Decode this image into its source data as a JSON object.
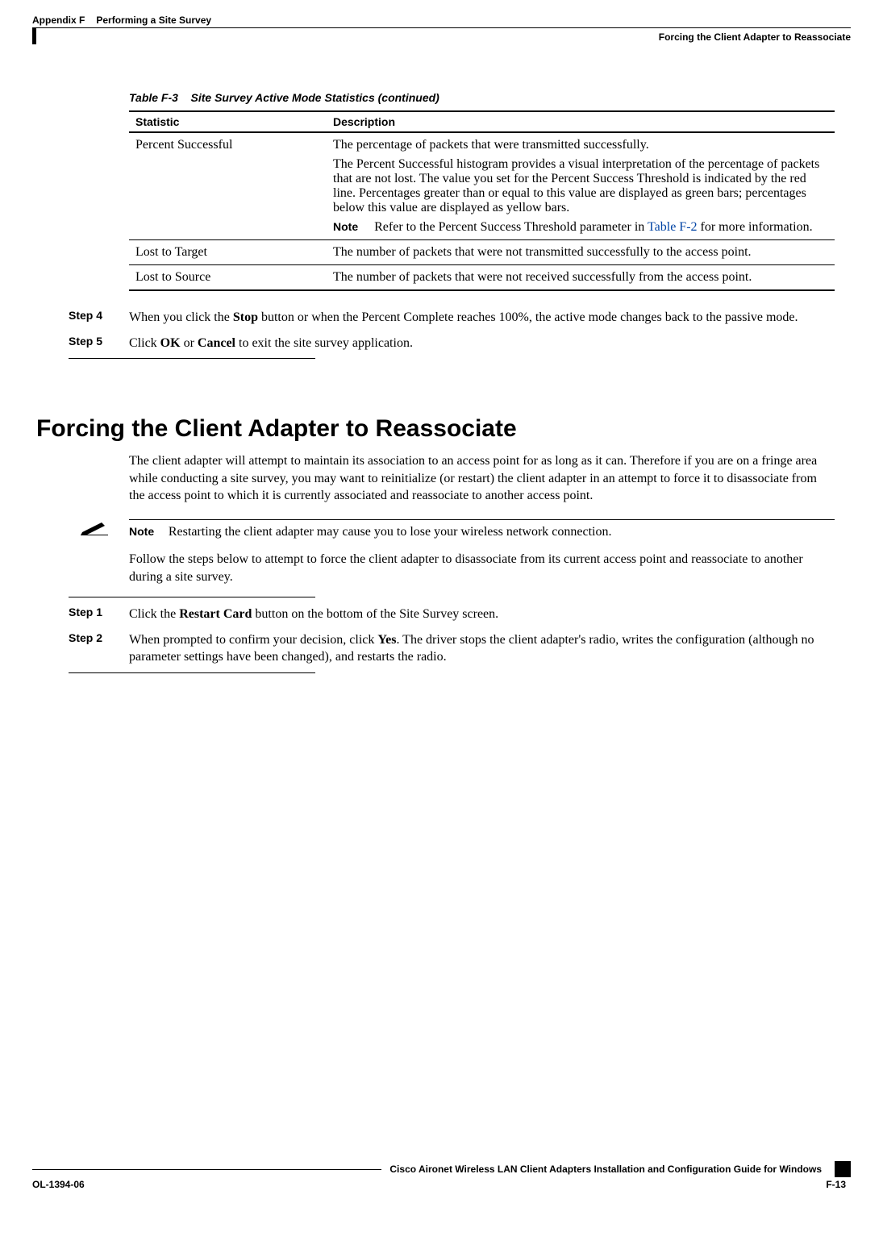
{
  "header": {
    "appendix": "Appendix F",
    "appendix_title": "Performing a Site Survey",
    "section_crumb": "Forcing the Client Adapter to Reassociate"
  },
  "table": {
    "caption_prefix": "Table F-3",
    "caption_title": "Site Survey Active Mode Statistics (continued)",
    "col1": "Statistic",
    "col2": "Description",
    "rows": [
      {
        "stat": "Percent Successful",
        "desc_p1": "The percentage of packets that were transmitted successfully.",
        "desc_p2": "The Percent Successful histogram provides a visual interpretation of the percentage of packets that are not lost. The value you set for the Percent Success Threshold is indicated by the red line. Percentages greater than or equal to this value are displayed as green bars; percentages below this value are displayed as yellow bars.",
        "note_label": "Note",
        "note_text_pre": "Refer to the Percent Success Threshold parameter in ",
        "note_link": "Table F-2",
        "note_text_post": " for more information."
      },
      {
        "stat": "Lost to Target",
        "desc": "The number of packets that were not transmitted successfully to the access point."
      },
      {
        "stat": "Lost to Source",
        "desc": "The number of packets that were not received successfully from the access point."
      }
    ]
  },
  "steps_upper": [
    {
      "label": "Step 4",
      "pre": "When you click the ",
      "b1": "Stop",
      "mid": " button or when the Percent Complete reaches 100%, the active mode changes back to the passive mode."
    },
    {
      "label": "Step 5",
      "pre": "Click ",
      "b1": "OK",
      "mid": " or ",
      "b2": "Cancel",
      "post": " to exit the site survey application."
    }
  ],
  "section_title": "Forcing the Client Adapter to Reassociate",
  "body_p1": "The client adapter will attempt to maintain its association to an access point for as long as it can. Therefore if you are on a fringe area while conducting a site survey, you may want to reinitialize (or restart) the client adapter in an attempt to force it to disassociate from the access point to which it is currently associated and reassociate to another access point.",
  "note": {
    "label": "Note",
    "text": "Restarting the client adapter may cause you to lose your wireless network connection."
  },
  "body_p2": "Follow the steps below to attempt to force the client adapter to disassociate from its current access point and reassociate to another during a site survey.",
  "steps_lower": [
    {
      "label": "Step 1",
      "pre": "Click the ",
      "b1": "Restart Card",
      "post": " button on the bottom of the Site Survey screen."
    },
    {
      "label": "Step 2",
      "pre": "When prompted to confirm your decision, click ",
      "b1": "Yes",
      "post": ". The driver stops the client adapter's radio, writes the configuration (although no parameter settings have been changed), and restarts the radio."
    }
  ],
  "footer": {
    "book_title": "Cisco Aironet Wireless LAN Client Adapters Installation and Configuration Guide for Windows",
    "doc_id": "OL-1394-06",
    "page_num": "F-13"
  }
}
